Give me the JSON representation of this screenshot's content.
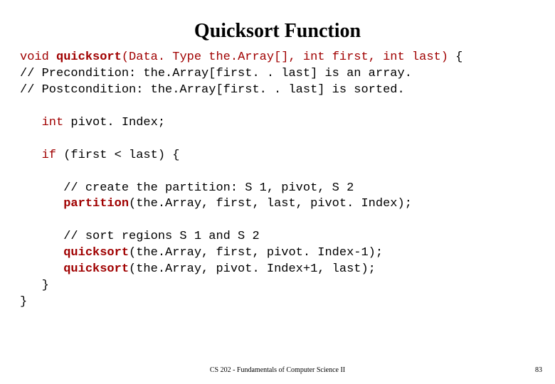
{
  "title": "Quicksort Function",
  "code": {
    "l1_kw": "void",
    "l1_fn": "quicksort",
    "l1_sig": "(Data. Type the.Array[], int first, int last)",
    "l1_brace": " {",
    "l2": "// Precondition: the.Array[first. . last] is an array.",
    "l3": "// Postcondition: the.Array[first. . last] is sorted.",
    "l4_kw": "   int",
    "l4_rest": " pivot. Index;",
    "l5_kw": "   if",
    "l5_rest": " (first < last) {",
    "l6": "      // create the partition: S 1, pivot, S 2",
    "l7_fn": "      partition",
    "l7_rest": "(the.Array, first, last, pivot. Index);",
    "l8": "      // sort regions S 1 and S 2",
    "l9_fn": "      quicksort",
    "l9_rest": "(the.Array, first, pivot. Index-1);",
    "l10_fn": "      quicksort",
    "l10_rest": "(the.Array, pivot. Index+1, last);",
    "l11": "   }",
    "l12": "}"
  },
  "footer": {
    "center": "CS 202 - Fundamentals of Computer Science II",
    "page": "83"
  }
}
